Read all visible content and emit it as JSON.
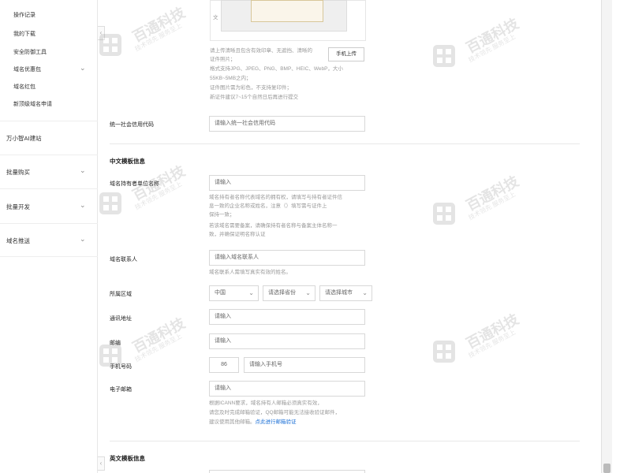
{
  "sidebar": {
    "items": [
      {
        "label": "操作记录"
      },
      {
        "label": "我的下载"
      },
      {
        "label": "安全防御工具"
      },
      {
        "label": "域名优惠包"
      },
      {
        "label": "域名红包"
      },
      {
        "label": "新顶级域名申请"
      }
    ],
    "groups": [
      {
        "label": "万小智AI建站"
      },
      {
        "label": "批量购买"
      },
      {
        "label": "批量开发"
      },
      {
        "label": "域名推送"
      }
    ]
  },
  "upload": {
    "preview_caption": "文",
    "hints": [
      "请上传清晰且包含有效印章、无遮挡、清晰的",
      "证件照片；",
      "格式支持JPG、JPEG、PNG、BMP、HEIC、WebP，大小",
      "55KB~5MB之内；",
      "证件图片需为彩色，不支持复印件；",
      "新证件建议7~15个自然日后再进行提交"
    ],
    "button_label": "手机上传"
  },
  "credit_code": {
    "label": "统一社会信用代码",
    "placeholder": "请输入统一社会信用代码"
  },
  "cn_section": {
    "title": "中文模板信息",
    "owner": {
      "label": "域名持有者单位名称",
      "placeholder": "请输入",
      "hints": [
        "域名持有者名称代表域名的拥有权，请填写与持有者证件信",
        "息一致的企业名称或姓名，注意（）填写需与证件上",
        "保持一致；",
        "若该域名需要备案，请确保持有者名称与备案主体名称一",
        "致，并确保证明名称认证"
      ]
    },
    "contact": {
      "label": "域名联系人",
      "placeholder": "请输入域名联系人",
      "hint": "域名联系人需填写真实有效的姓名。"
    },
    "region": {
      "label": "所属区域",
      "country": "中国",
      "province": "请选择省份",
      "city": "请选择城市"
    },
    "address": {
      "label": "通讯地址",
      "placeholder": "请输入"
    },
    "zip": {
      "label": "邮编",
      "placeholder": "请输入"
    },
    "phone": {
      "label": "手机号码",
      "code": "86",
      "placeholder": "请输入手机号"
    },
    "email": {
      "label": "电子邮箱",
      "placeholder": "请输入",
      "hints": [
        "根据ICANN要求，域名持有人邮箱必须真实有效，",
        "请您及时完成邮箱验证，QQ邮箱可能无法接收验证邮件，",
        "建议使用其他邮箱。"
      ],
      "link": "点此进行邮箱验证"
    }
  },
  "en_section": {
    "title": "英文模板信息"
  },
  "watermark": {
    "brand": "百通科技",
    "slogan": "技术领先 服务至上"
  },
  "colors": {
    "link": "#1a6fd6",
    "border": "#d8d8d8",
    "hint": "#999999"
  }
}
